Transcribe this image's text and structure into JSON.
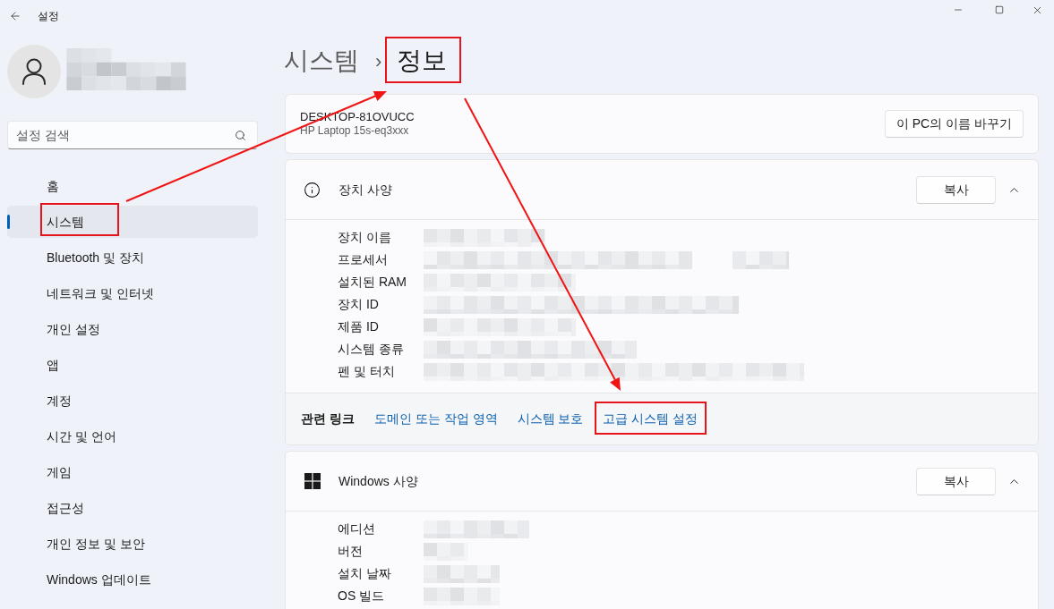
{
  "window": {
    "title": "설정"
  },
  "search": {
    "placeholder": "설정 검색"
  },
  "sidebar": {
    "items": [
      {
        "label": "홈",
        "selected": false,
        "highlighted": false
      },
      {
        "label": "시스템",
        "selected": true,
        "highlighted": true
      },
      {
        "label": "Bluetooth 및 장치",
        "selected": false,
        "highlighted": false
      },
      {
        "label": "네트워크 및 인터넷",
        "selected": false,
        "highlighted": false
      },
      {
        "label": "개인 설정",
        "selected": false,
        "highlighted": false
      },
      {
        "label": "앱",
        "selected": false,
        "highlighted": false
      },
      {
        "label": "계정",
        "selected": false,
        "highlighted": false
      },
      {
        "label": "시간 및 언어",
        "selected": false,
        "highlighted": false
      },
      {
        "label": "게임",
        "selected": false,
        "highlighted": false
      },
      {
        "label": "접근성",
        "selected": false,
        "highlighted": false
      },
      {
        "label": "개인 정보 및 보안",
        "selected": false,
        "highlighted": false
      },
      {
        "label": "Windows 업데이트",
        "selected": false,
        "highlighted": false
      }
    ]
  },
  "breadcrumb": {
    "parent": "시스템",
    "separator": "›",
    "current": "정보",
    "highlighted": true
  },
  "device": {
    "name": "DESKTOP-81OVUCC",
    "model": "HP Laptop 15s-eq3xxx",
    "rename_button": "이 PC의 이름 바꾸기"
  },
  "sections": [
    {
      "kind": "device",
      "title": "장치 사양",
      "copy_button": "복사",
      "expanded": true,
      "rows": [
        "장치 이름",
        "프로세서",
        "설치된 RAM",
        "장치 ID",
        "제품 ID",
        "시스템 종류",
        "펜 및 터치"
      ],
      "related": {
        "label": "관련 링크",
        "links": [
          {
            "label": "도메인 또는 작업 영역",
            "highlighted": false
          },
          {
            "label": "시스템 보호",
            "highlighted": false
          },
          {
            "label": "고급 시스템 설정",
            "highlighted": true
          }
        ]
      }
    },
    {
      "kind": "windows",
      "title": "Windows 사양",
      "copy_button": "복사",
      "expanded": true,
      "rows": [
        "에디션",
        "버전",
        "설치 날짜",
        "OS 빌드"
      ]
    }
  ]
}
